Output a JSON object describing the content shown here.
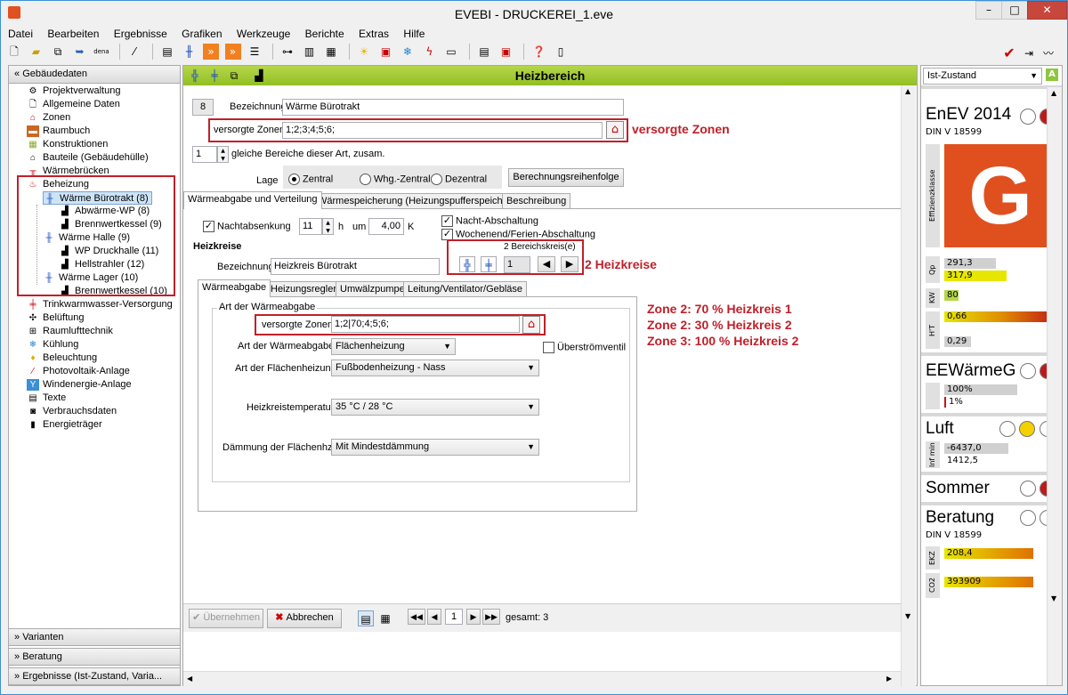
{
  "app": {
    "title": "EVEBI - DRUCKEREI_1.eve",
    "window_buttons": {
      "minimize": "–",
      "maximize": "□",
      "close": "✕"
    }
  },
  "menu": [
    "Datei",
    "Bearbeiten",
    "Ergebnisse",
    "Grafiken",
    "Werkzeuge",
    "Berichte",
    "Extras",
    "Hilfe"
  ],
  "sidebar": {
    "header": "Gebäudedaten",
    "items": [
      {
        "label": "Projektverwaltung",
        "icon": "gear-icon"
      },
      {
        "label": "Allgemeine Daten",
        "icon": "document-icon"
      },
      {
        "label": "Zonen",
        "icon": "house-icon"
      },
      {
        "label": "Raumbuch",
        "icon": "book-icon"
      },
      {
        "label": "Konstruktionen",
        "icon": "wall-icon"
      },
      {
        "label": "Bauteile (Gebäudehülle)",
        "icon": "building-icon"
      },
      {
        "label": "Wärmebrücken",
        "icon": "bridge-icon"
      },
      {
        "label": "Beheizung",
        "icon": "heating-icon"
      },
      {
        "label": "Wärme Bürotrakt (8)",
        "icon": "radiator-icon"
      },
      {
        "label": "Abwärme-WP (8)",
        "icon": "pipe-icon"
      },
      {
        "label": "Brennwertkessel (9)",
        "icon": "pipe-icon"
      },
      {
        "label": "Wärme Halle (9)",
        "icon": "radiator-icon"
      },
      {
        "label": "WP Druckhalle (11)",
        "icon": "pipe-icon"
      },
      {
        "label": "Hellstrahler (12)",
        "icon": "pipe-icon"
      },
      {
        "label": "Wärme Lager (10)",
        "icon": "radiator-icon"
      },
      {
        "label": "Brennwertkessel (10)",
        "icon": "pipe-icon"
      },
      {
        "label": "Trinkwarmwasser-Versorgung",
        "icon": "water-icon"
      },
      {
        "label": "Belüftung",
        "icon": "fan-icon"
      },
      {
        "label": "Raumlufttechnik",
        "icon": "ventilation-icon"
      },
      {
        "label": "Kühlung",
        "icon": "snowflake-icon"
      },
      {
        "label": "Beleuchtung",
        "icon": "bulb-icon"
      },
      {
        "label": "Photovoltaik-Anlage",
        "icon": "solar-icon"
      },
      {
        "label": "Windenergie-Anlage",
        "icon": "wind-icon"
      },
      {
        "label": "Texte",
        "icon": "text-icon"
      },
      {
        "label": "Verbrauchsdaten",
        "icon": "meter-icon"
      },
      {
        "label": "Energieträger",
        "icon": "fuel-icon"
      }
    ],
    "footer": [
      "Varianten",
      "Beratung",
      "Ergebnisse (Ist-Zustand, Varia..."
    ]
  },
  "content": {
    "title": "Heizbereich",
    "number": "8",
    "bezeichnung_label": "Bezeichnung",
    "bezeichnung_value": "Wärme Bürotrakt",
    "versorgte_label": "versorgte Zonen",
    "versorgte_value": "1;2;3;4;5;6;",
    "count_value": "1",
    "gleiche_label": "gleiche Bereiche dieser Art, zusam.",
    "lage_label": "Lage",
    "lage_options": [
      "Zentral",
      "Whg.-Zentral",
      "Dezentral"
    ],
    "berechnung_button": "Berechnungsreihenfolge",
    "tabs": [
      "Wärmeabgabe und Verteilung",
      "Wärmespeicherung (Heizungspufferspeicher)",
      "Beschreibung"
    ],
    "nacht_label": "Nachtabsenkung",
    "nacht_hours": "11",
    "h_label": "h",
    "um_label": "um",
    "nacht_k": "4,00",
    "k_label": "K",
    "nacht_abschaltung": "Nacht-Abschaltung",
    "wochenend": "Wochenend/Ferien-Abschaltung",
    "heizkreise_label": "Heizkreise",
    "bereichskreis_label": "2 Bereichskreis(e)",
    "kreis_index": "1",
    "kreis_bezeichnung": "Heizkreis Bürotrakt",
    "subtabs": [
      "Wärmeabgabe",
      "Heizungsregler",
      "Umwälzpumpe",
      "Leitung/Ventilator/Gebläse"
    ],
    "group_label": "Art der Wärmeabgabe",
    "zone_value": "1;2|70;4;5;6;",
    "art_label": "Art der Wärmeabgabe",
    "art_value": "Flächenheizung",
    "ueberstroem": "Überströmventil",
    "flaechen_label": "Art der Flächenheizung",
    "flaechen_value": "Fußbodenheizung - Nass",
    "temp_label": "Heizkreistemperatur",
    "temp_value": "35 °C / 28 °C",
    "daemm_label": "Dämmung der Flächenhzg.",
    "daemm_value": "Mit Mindestdämmung",
    "uebernehmen": "Übernehmen",
    "abbrechen": "Abbrechen",
    "page": "1",
    "gesamt": "gesamt: 3"
  },
  "annotations": {
    "versorgte": "versorgte Zonen",
    "heizkreise": "2 Heizkreise",
    "zone_lines": [
      "Zone 2: 70 % Heizkreis 1",
      "Zone 2: 30 % Heizkreis 2",
      "Zone 3: 100 % Heizkreis 2"
    ]
  },
  "right_panel": {
    "state": "Ist-Zustand",
    "enev_title": "EnEV 2014",
    "enev_norm": "DIN V 18599",
    "effizienz_label": "Effizienzklasse",
    "grade": "G",
    "grade_color": "#e0501e",
    "qp_label": "Qp",
    "qp_values": [
      "291,3",
      "317,9"
    ],
    "kw_label": "KW",
    "kw_value": "80",
    "ht_label": "H'T",
    "ht_values": [
      "0,66",
      "0,29"
    ],
    "ee_title": "EEWärmeG",
    "ee_values": [
      "100%",
      "1%"
    ],
    "luft_title": "Luft",
    "luft_label": "Inf min",
    "luft_values": [
      "-6437,0",
      "1412,5"
    ],
    "sommer_title": "Sommer",
    "beratung_title": "Beratung",
    "beratung_norm": "DIN V 18599",
    "ekz_label": "EKZ",
    "ekz_value": "208,4",
    "co2_label": "CO2",
    "co2_value": "393909"
  }
}
